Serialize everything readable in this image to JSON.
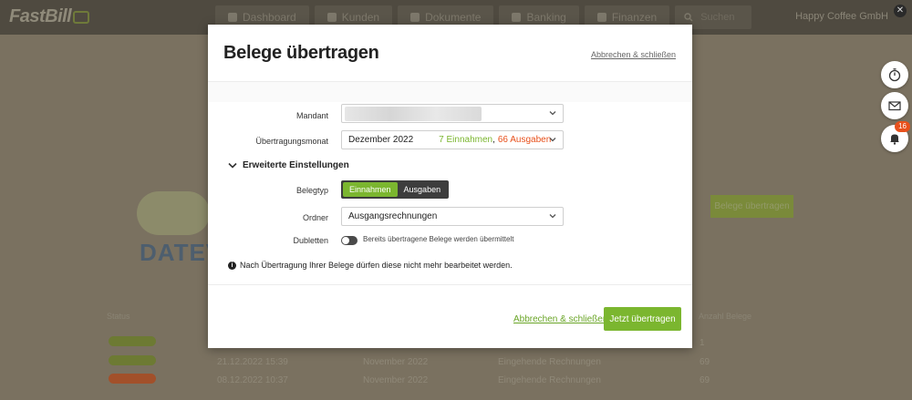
{
  "app": {
    "logo": "FastBill",
    "company": "Happy Coffee GmbH",
    "close_icon": "close-icon",
    "nav": [
      {
        "label": "Dashboard",
        "icon": "dashboard-icon"
      },
      {
        "label": "Kunden",
        "icon": "customers-icon"
      },
      {
        "label": "Dokumente",
        "icon": "documents-icon"
      },
      {
        "label": "Banking",
        "icon": "banking-icon"
      },
      {
        "label": "Finanzen",
        "icon": "finance-icon"
      }
    ],
    "search_label": "Suchen"
  },
  "background": {
    "datev_label": "DATEV",
    "transfer_button": "Belege übertragen",
    "table_headers": {
      "status": "Status",
      "count": "Anzahl Belege"
    },
    "rows": [
      {
        "date": "",
        "month": "",
        "type": "",
        "count": "1",
        "status_color": "#6d7a33"
      },
      {
        "date": "21.12.2022 15:39",
        "month": "November 2022",
        "type": "Eingehende Rechnungen",
        "count": "69",
        "status_color": "#6d7a33"
      },
      {
        "date": "08.12.2022 10:37",
        "month": "November 2022",
        "type": "Eingehende Rechnungen",
        "count": "69",
        "status_color": "#a2502a"
      }
    ]
  },
  "side_buttons": {
    "timer_icon": "stopwatch-icon",
    "mail_icon": "mail-icon",
    "bell_icon": "bell-icon",
    "notification_count": "16"
  },
  "modal": {
    "title": "Belege übertragen",
    "cancel_top": "Abbrechen & schließen",
    "fields": {
      "mandant_label": "Mandant",
      "mandant_value": "",
      "month_label": "Übertragungsmonat",
      "month_value": "Dezember 2022",
      "income_text": "7 Einnahmen",
      "separator": ",",
      "expense_text": "66 Ausgaben"
    },
    "advanced": {
      "heading": "Erweiterte Einstellungen",
      "belegtyp_label": "Belegtyp",
      "belegtyp_options": [
        "Einnahmen",
        "Ausgaben"
      ],
      "ordner_label": "Ordner",
      "ordner_value": "Ausgangsrechnungen",
      "dubletten_label": "Dubletten",
      "dubletten_text": "Bereits übertragene Belege werden übermittelt"
    },
    "info_text": "Nach Übertragung Ihrer Belege dürfen diese nicht mehr bearbeitet werden.",
    "cancel_bottom": "Abbrechen & schließen",
    "submit": "Jetzt übertragen"
  },
  "colors": {
    "accent": "#7bb62f",
    "expense": "#e8501b"
  }
}
